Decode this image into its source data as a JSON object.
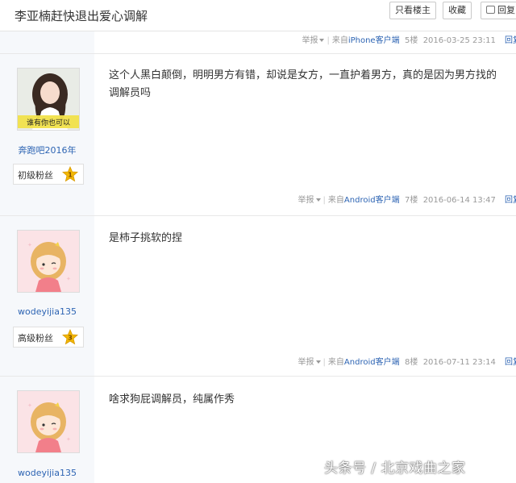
{
  "header": {
    "title": "李亚楠赶快退出爱心调解",
    "buttons": {
      "only_host": "只看楼主",
      "favorite": "收藏",
      "reply": "回复"
    }
  },
  "top_meta": {
    "report": "举报",
    "source": "来自",
    "client": "iPhone客户端",
    "floor": "5楼",
    "time": "2016-03-25 23:11",
    "reply": "回复"
  },
  "posts": [
    {
      "username": "奔跑吧2016年",
      "avatar_caption": "谁有你也可以",
      "level_label": "初级粉丝",
      "level": "1",
      "content": "这个人黑白颠倒，明明男方有错，却说是女方，一直护着男方，真的是因为男方找的调解员吗",
      "meta": {
        "report": "举报",
        "source": "来自",
        "client": "Android客户端",
        "floor": "7楼",
        "time": "2016-06-14 13:47",
        "reply": "回复"
      }
    },
    {
      "username": "wodeyijia135",
      "level_label": "高级粉丝",
      "level": "3",
      "content": "是柿子挑软的捏",
      "meta": {
        "report": "举报",
        "source": "来自",
        "client": "Android客户端",
        "floor": "8楼",
        "time": "2016-07-11 23:14",
        "reply": "回复"
      }
    },
    {
      "username": "wodeyijia135",
      "content": "啥求狗屁调解员，纯属作秀"
    }
  ],
  "watermark": "头条号 / 北京戏曲之家",
  "colors": {
    "link": "#2d64b3",
    "meta": "#999999",
    "sidebar": "#f6f8fb",
    "star": "#f2b705"
  }
}
